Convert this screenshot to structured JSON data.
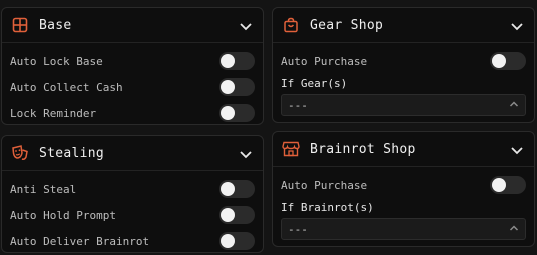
{
  "accent": "#e0603a",
  "panels": {
    "base": {
      "title": "Base",
      "icon": "grid-icon",
      "items": [
        {
          "label": "Auto Lock Base",
          "on": false
        },
        {
          "label": "Auto Collect Cash",
          "on": false
        },
        {
          "label": "Lock Reminder",
          "on": false
        }
      ]
    },
    "stealing": {
      "title": "Stealing",
      "icon": "masks-icon",
      "items": [
        {
          "label": "Anti Steal",
          "on": false
        },
        {
          "label": "Auto Hold Prompt",
          "on": false
        },
        {
          "label": "Auto Deliver Brainrot",
          "on": false
        }
      ]
    },
    "gear_shop": {
      "title": "Gear Shop",
      "icon": "shopping-bag-icon",
      "auto_purchase": "Auto Purchase",
      "auto_purchase_on": false,
      "select_label": "If Gear(s)",
      "select_value": "---"
    },
    "brainrot_shop": {
      "title": "Brainrot Shop",
      "icon": "store-icon",
      "auto_purchase": "Auto Purchase",
      "auto_purchase_on": false,
      "select_label": "If Brainrot(s)",
      "select_value": "---"
    }
  }
}
